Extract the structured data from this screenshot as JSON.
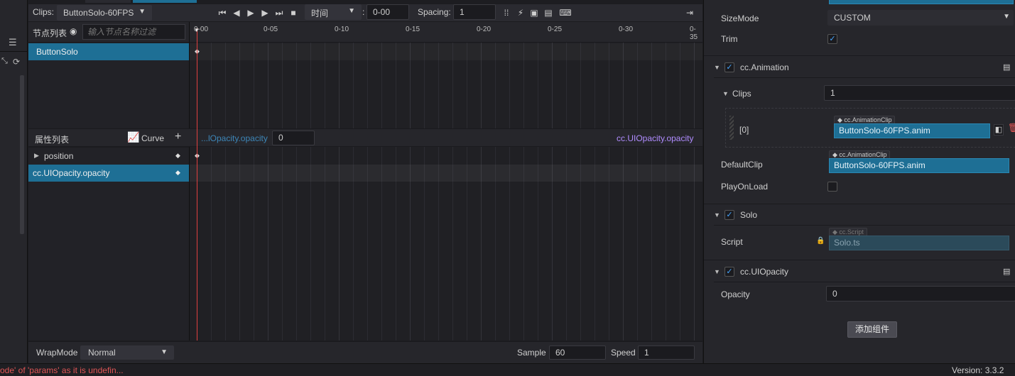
{
  "toolbar": {
    "clips_label": "Clips:",
    "clip_name": "ButtonSolo-60FPS",
    "time_mode": "时间",
    "time_value": "0-00",
    "spacing_label": "Spacing:",
    "spacing_value": "1"
  },
  "nodes": {
    "header": "节点列表",
    "filter_placeholder": "输入节点名称过滤",
    "items": [
      "ButtonSolo"
    ]
  },
  "timeline": {
    "ticks": [
      "0-00",
      "0-05",
      "0-10",
      "0-15",
      "0-20",
      "0-25",
      "0-30",
      "0-35"
    ]
  },
  "properties": {
    "header": "属性列表",
    "curve_label": "Curve",
    "add": "+",
    "current_prop": "...lOpacity.opacity",
    "current_value": "0",
    "current_full": "cc.UIOpacity.opacity",
    "items": [
      "position",
      "cc.UIOpacity.opacity"
    ]
  },
  "footer": {
    "wrapmode_label": "WrapMode",
    "wrapmode_value": "Normal",
    "sample_label": "Sample",
    "sample_value": "60",
    "speed_label": "Speed",
    "speed_value": "1"
  },
  "inspector": {
    "sizemode_label": "SizeMode",
    "sizemode_value": "CUSTOM",
    "trim_label": "Trim",
    "animation": {
      "title": "cc.Animation",
      "clips_label": "Clips",
      "clips_count": "1",
      "clip_index": "[0]",
      "clip_type": "cc.AnimationClip",
      "clip_value": "ButtonSolo-60FPS.anim",
      "default_label": "DefaultClip",
      "default_type": "cc.AnimationClip",
      "default_value": "ButtonSolo-60FPS.anim",
      "playonload_label": "PlayOnLoad"
    },
    "solo": {
      "title": "Solo",
      "script_label": "Script",
      "script_type": "cc.Script",
      "script_value": "Solo.ts"
    },
    "uiopacity": {
      "title": "cc.UIOpacity",
      "opacity_label": "Opacity",
      "opacity_value": "0"
    },
    "add_component": "添加组件"
  },
  "status": {
    "error": "ode' of 'params' as it is undefin...",
    "version": "Version: 3.3.2"
  },
  "colors": {
    "selection": "#1e6f95",
    "playhead": "#e04040",
    "accent_purple": "#b08cff",
    "prop_link": "#3d86b8",
    "error": "#e05555"
  }
}
